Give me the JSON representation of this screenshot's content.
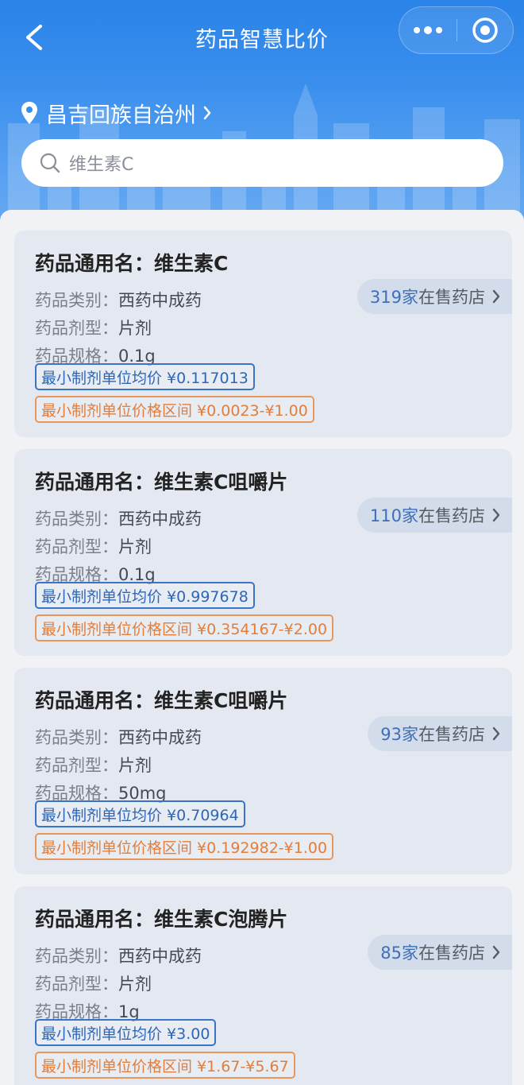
{
  "navbar": {
    "title": "药品智慧比价"
  },
  "location": {
    "name": "昌吉回族自治州"
  },
  "search": {
    "value": "维生素C"
  },
  "labels": {
    "name_prefix": "药品通用名：",
    "category": "药品类别：",
    "form": "药品剂型：",
    "spec": "药品规格：",
    "avg_prefix": "最小制剂单位均价 ",
    "range_prefix": "最小制剂单位价格区间 ",
    "store_suffix": "在售药店"
  },
  "drugs": [
    {
      "name": "维生素C",
      "category": "西药中成药",
      "form": "片剂",
      "spec": "0.1g",
      "avg_price": "¥0.117013",
      "price_range": "¥0.0023-¥1.00",
      "store_count": "319家"
    },
    {
      "name": "维生素C咀嚼片",
      "category": "西药中成药",
      "form": "片剂",
      "spec": "0.1g",
      "avg_price": "¥0.997678",
      "price_range": "¥0.354167-¥2.00",
      "store_count": "110家"
    },
    {
      "name": "维生素C咀嚼片",
      "category": "西药中成药",
      "form": "片剂",
      "spec": "50mg",
      "avg_price": "¥0.70964",
      "price_range": "¥0.192982-¥1.00",
      "store_count": "93家"
    },
    {
      "name": "维生素C泡腾片",
      "category": "西药中成药",
      "form": "片剂",
      "spec": "1g",
      "avg_price": "¥3.00",
      "price_range": "¥1.67-¥5.67",
      "store_count": "85家"
    }
  ],
  "colors": {
    "header_blue": "#2a83e8",
    "avg_tag": "#3a74c7",
    "range_tag": "#e47d39",
    "store_count": "#3f6fb8"
  }
}
